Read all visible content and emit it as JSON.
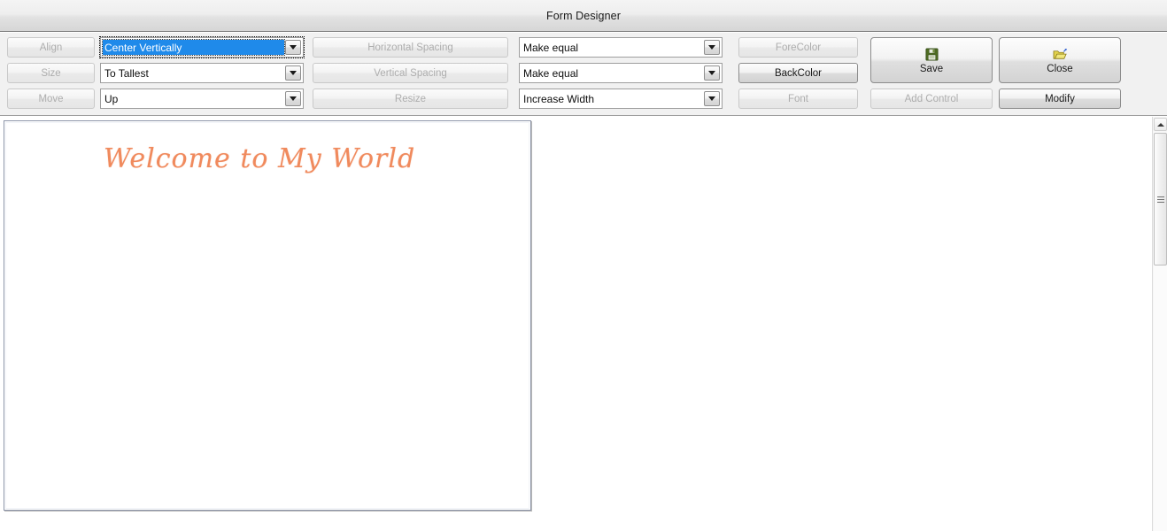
{
  "window": {
    "title": "Form Designer"
  },
  "toolbar": {
    "col_actions": [
      {
        "label": "Align",
        "enabled": false,
        "name": "align-button"
      },
      {
        "label": "Size",
        "enabled": false,
        "name": "size-button"
      },
      {
        "label": "Move",
        "enabled": false,
        "name": "move-button"
      }
    ],
    "col_action_combos": [
      {
        "value": "Center Vertically",
        "focused": true,
        "name": "align-mode-combobox"
      },
      {
        "value": "To Tallest",
        "focused": false,
        "name": "size-mode-combobox"
      },
      {
        "value": "Up",
        "focused": false,
        "name": "move-direction-combobox"
      }
    ],
    "col_spacing": [
      {
        "label": "Horizontal Spacing",
        "enabled": false,
        "name": "horizontal-spacing-button"
      },
      {
        "label": "Vertical Spacing",
        "enabled": false,
        "name": "vertical-spacing-button"
      },
      {
        "label": "Resize",
        "enabled": false,
        "name": "resize-button"
      }
    ],
    "col_spacing_combos": [
      {
        "value": "Make equal",
        "name": "horizontal-spacing-combobox"
      },
      {
        "value": "Make equal",
        "name": "vertical-spacing-combobox"
      },
      {
        "value": "Increase Width",
        "name": "resize-mode-combobox"
      }
    ],
    "col_style": [
      {
        "label": "ForeColor",
        "enabled": false,
        "name": "forecolor-button"
      },
      {
        "label": "BackColor",
        "enabled": true,
        "name": "backcolor-button"
      },
      {
        "label": "Font",
        "enabled": false,
        "name": "font-button"
      }
    ],
    "save_button": {
      "label": "Save",
      "icon": "floppy-disk-icon",
      "enabled": true
    },
    "close_button": {
      "label": "Close",
      "icon": "open-folder-icon",
      "enabled": true
    },
    "add_control_button": {
      "label": "Add Control",
      "enabled": false
    },
    "modify_button": {
      "label": "Modify",
      "enabled": true
    }
  },
  "designer": {
    "welcome_label": "Welcome to My World"
  },
  "colors": {
    "selection_blue": "#1f8aea",
    "welcome_text": "#f08a5d",
    "toolbar_background": "#f1f1f1",
    "save_icon": "#4d6b1f",
    "close_icon": "#e8d95a"
  }
}
